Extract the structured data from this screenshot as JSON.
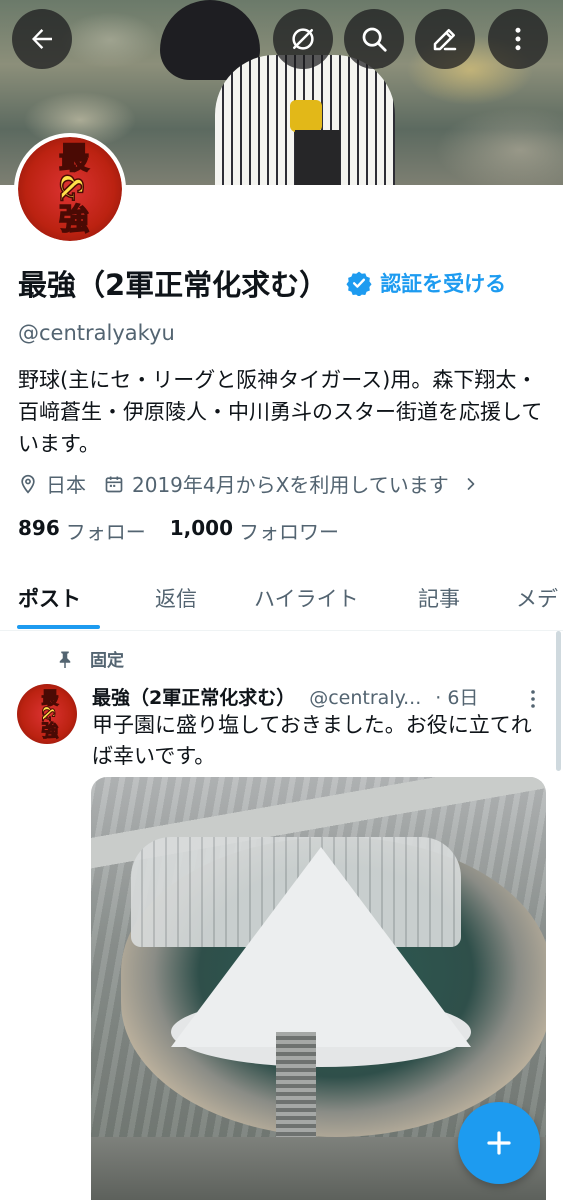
{
  "header": {
    "back_icon": "arrow-left-icon",
    "actions": [
      "grok-icon",
      "search-icon",
      "compose-icon",
      "more-icon"
    ]
  },
  "profile": {
    "avatar_text": "最&強",
    "display_name": "最強（2軍正常化求む）",
    "verify_label": "認証を受ける",
    "handle": "@centralyakyu",
    "bio": "野球(主にセ・リーグと阪神タイガース)用。森下翔太・百﨑蒼生・伊原陵人・中川勇斗のスター街道を応援しています。",
    "location": "日本",
    "joined": "2019年4月からXを利用しています",
    "following_count": "896",
    "following_label": "フォロー",
    "followers_count": "1,000",
    "followers_label": "フォロワー"
  },
  "tabs": [
    "ポスト",
    "返信",
    "ハイライト",
    "記事",
    "メデ"
  ],
  "active_tab": "ポスト",
  "post": {
    "pinned_label": "固定",
    "avatar_text": "最&強",
    "name": "最強（2軍正常化求む）",
    "handle": "@centraly...",
    "time": "· 6日",
    "text": "甲子園に盛り塩しておきました。お役に立てれば幸いです。"
  },
  "colors": {
    "accent": "#1d9bf0",
    "text_primary": "#0f1419",
    "text_secondary": "#536471"
  }
}
